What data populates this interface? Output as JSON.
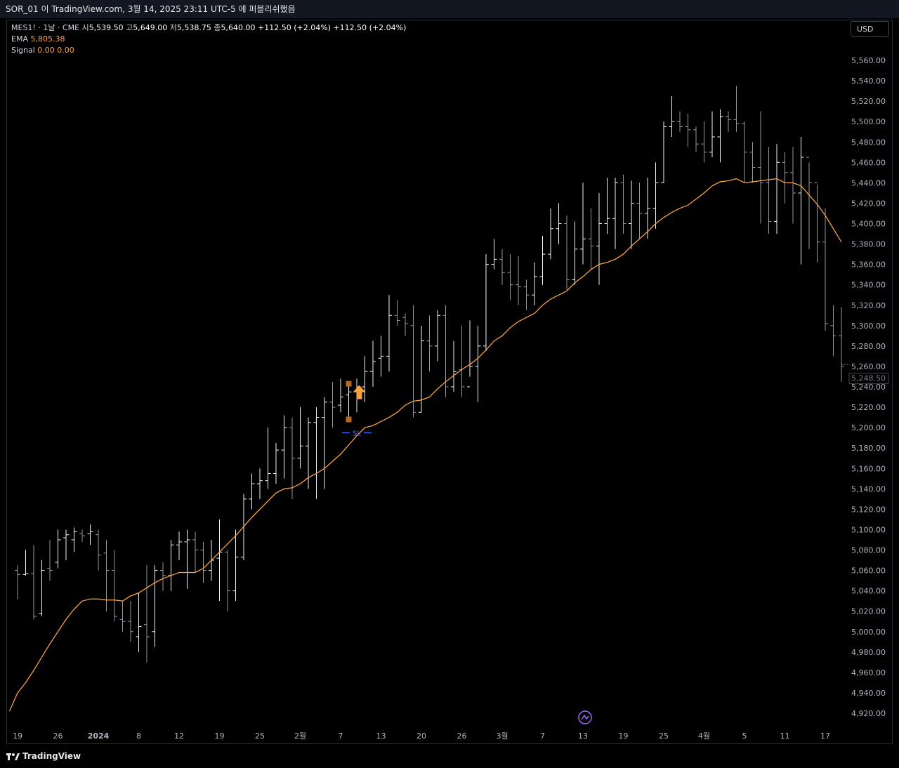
{
  "header": {
    "title": "SOR_01 이 TradingView.com, 3월 14, 2025 23:11 UTC-5 에 퍼블리쉬했음"
  },
  "legend": {
    "symbol": "MES1! · 1날 · CME",
    "open_label": "시",
    "open": "5,539.50",
    "high_label": "고",
    "high": "5,649.00",
    "low_label": "저",
    "low": "5,538.75",
    "close_label": "종",
    "close": "5,640.00",
    "change1": "+112.50 (+2.04%)",
    "change2": "+112.50 (+2.04%)",
    "ema_label": "EMA",
    "ema_value": "5,805.38",
    "signal_label": "Signal",
    "signal_v1": "0.00",
    "signal_v2": "0.00"
  },
  "currency": "USD",
  "brand": "TradingView",
  "stop_loss_label": "SL",
  "colors": {
    "background": "#000000",
    "bar": "#d1d4dc",
    "ema": "#f7a241",
    "signal_marker": "#f7a241",
    "stop_loss": "#2962ff",
    "price_tag": "#434651"
  },
  "chart_data": {
    "type": "ohlc",
    "title": "",
    "price_axis": {
      "ticks": [
        5560,
        5540,
        5520,
        5500,
        5480,
        5460,
        5440,
        5420,
        5400,
        5380,
        5360,
        5340,
        5320,
        5300,
        5280,
        5260,
        5240,
        5220,
        5200,
        5180,
        5160,
        5140,
        5120,
        5100,
        5080,
        5060,
        5040,
        5020,
        5000,
        4980,
        4960,
        4940,
        4920
      ],
      "tick_labels": [
        "5,560.00",
        "5,540.00",
        "5,520.00",
        "5,500.00",
        "5,480.00",
        "5,460.00",
        "5,440.00",
        "5,420.00",
        "5,400.00",
        "5,380.00",
        "5,360.00",
        "5,340.00",
        "5,320.00",
        "5,300.00",
        "5,280.00",
        "5,260.00",
        "5,240.00",
        "5,220.00",
        "5,200.00",
        "5,180.00",
        "5,160.00",
        "5,140.00",
        "5,120.00",
        "5,100.00",
        "5,080.00",
        "5,060.00",
        "5,040.00",
        "5,020.00",
        "5,000.00",
        "4,980.00",
        "4,960.00",
        "4,940.00",
        "4,920.00"
      ],
      "range": [
        4910,
        5580
      ],
      "last_price_label": "5,248.50",
      "last_price": 5248.5
    },
    "time_axis": {
      "labels": [
        "19",
        "26",
        "2024",
        "8",
        "12",
        "19",
        "25",
        "2월",
        "7",
        "13",
        "20",
        "26",
        "3월",
        "7",
        "13",
        "19",
        "25",
        "4월",
        "5",
        "11",
        "17"
      ],
      "label_bar_index": [
        0,
        5,
        10,
        15,
        20,
        25,
        30,
        35,
        40,
        45,
        50,
        55,
        60,
        65,
        70,
        75,
        80,
        85,
        90,
        95,
        100
      ]
    },
    "bars": [
      [
        5060,
        5065,
        5032,
        5056
      ],
      [
        5056,
        5080,
        5055,
        5057
      ],
      [
        5057,
        5085,
        5012,
        5015
      ],
      [
        5018,
        5070,
        5015,
        5060
      ],
      [
        5062,
        5090,
        5050,
        5060
      ],
      [
        5068,
        5100,
        5062,
        5090
      ],
      [
        5092,
        5100,
        5070,
        5095
      ],
      [
        5090,
        5102,
        5078,
        5098
      ],
      [
        5096,
        5100,
        5088,
        5094
      ],
      [
        5096,
        5105,
        5085,
        5098
      ],
      [
        5095,
        5100,
        5060,
        5075
      ],
      [
        5077,
        5090,
        5020,
        5060
      ],
      [
        5060,
        5080,
        5010,
        5015
      ],
      [
        5012,
        5030,
        5000,
        5010
      ],
      [
        5010,
        5030,
        4990,
        5000
      ],
      [
        4995,
        5038,
        4980,
        5005
      ],
      [
        5007,
        5065,
        4970,
        4995
      ],
      [
        5000,
        5065,
        4985,
        5060
      ],
      [
        5060,
        5068,
        5040,
        5055
      ],
      [
        5055,
        5090,
        5040,
        5085
      ],
      [
        5085,
        5098,
        5070,
        5088
      ],
      [
        5088,
        5100,
        5042,
        5090
      ],
      [
        5090,
        5098,
        5058,
        5080
      ],
      [
        5080,
        5088,
        5048,
        5060
      ],
      [
        5060,
        5090,
        5050,
        5070
      ],
      [
        5072,
        5110,
        5030,
        5078
      ],
      [
        5078,
        5080,
        5020,
        5040
      ],
      [
        5040,
        5100,
        5030,
        5073
      ],
      [
        5073,
        5135,
        5070,
        5130
      ],
      [
        5130,
        5155,
        5120,
        5145
      ],
      [
        5145,
        5160,
        5130,
        5148
      ],
      [
        5148,
        5200,
        5140,
        5155
      ],
      [
        5155,
        5185,
        5145,
        5178
      ],
      [
        5178,
        5212,
        5150,
        5200
      ],
      [
        5200,
        5210,
        5130,
        5170
      ],
      [
        5170,
        5220,
        5160,
        5182
      ],
      [
        5182,
        5210,
        5140,
        5205
      ],
      [
        5205,
        5220,
        5130,
        5210
      ],
      [
        5210,
        5230,
        5140,
        5225
      ],
      [
        5225,
        5245,
        5200,
        5220
      ],
      [
        5222,
        5248,
        5215,
        5230
      ],
      [
        5232,
        5243,
        5210,
        5235
      ],
      [
        5235,
        5248,
        5215,
        5240
      ],
      [
        5240,
        5270,
        5225,
        5255
      ],
      [
        5255,
        5285,
        5240,
        5265
      ],
      [
        5268,
        5290,
        5250,
        5270
      ],
      [
        5270,
        5330,
        5255,
        5310
      ],
      [
        5310,
        5325,
        5300,
        5305
      ],
      [
        5308,
        5312,
        5290,
        5302
      ],
      [
        5300,
        5320,
        5210,
        5215
      ],
      [
        5215,
        5300,
        5215,
        5285
      ],
      [
        5285,
        5310,
        5255,
        5280
      ],
      [
        5280,
        5315,
        5265,
        5310
      ],
      [
        5310,
        5320,
        5230,
        5240
      ],
      [
        5240,
        5285,
        5235,
        5255
      ],
      [
        5257,
        5300,
        5230,
        5240
      ],
      [
        5240,
        5305,
        5250,
        5260
      ],
      [
        5260,
        5300,
        5225,
        5280
      ],
      [
        5280,
        5370,
        5275,
        5360
      ],
      [
        5360,
        5385,
        5355,
        5365
      ],
      [
        5365,
        5375,
        5340,
        5352
      ],
      [
        5352,
        5370,
        5325,
        5340
      ],
      [
        5340,
        5368,
        5320,
        5338
      ],
      [
        5338,
        5345,
        5315,
        5330
      ],
      [
        5330,
        5362,
        5320,
        5348
      ],
      [
        5348,
        5388,
        5340,
        5370
      ],
      [
        5370,
        5415,
        5365,
        5395
      ],
      [
        5395,
        5420,
        5380,
        5400
      ],
      [
        5400,
        5408,
        5335,
        5345
      ],
      [
        5345,
        5402,
        5340,
        5375
      ],
      [
        5375,
        5440,
        5360,
        5385
      ],
      [
        5385,
        5415,
        5355,
        5378
      ],
      [
        5378,
        5430,
        5340,
        5400
      ],
      [
        5400,
        5445,
        5390,
        5405
      ],
      [
        5405,
        5445,
        5375,
        5440
      ],
      [
        5440,
        5448,
        5390,
        5400
      ],
      [
        5400,
        5442,
        5375,
        5420
      ],
      [
        5420,
        5440,
        5385,
        5410
      ],
      [
        5410,
        5445,
        5385,
        5415
      ],
      [
        5415,
        5460,
        5395,
        5440
      ],
      [
        5440,
        5500,
        5440,
        5495
      ],
      [
        5495,
        5525,
        5485,
        5500
      ],
      [
        5500,
        5510,
        5490,
        5495
      ],
      [
        5495,
        5508,
        5475,
        5492
      ],
      [
        5492,
        5495,
        5470,
        5478
      ],
      [
        5478,
        5500,
        5460,
        5470
      ],
      [
        5470,
        5510,
        5465,
        5485
      ],
      [
        5485,
        5512,
        5460,
        5505
      ],
      [
        5505,
        5510,
        5490,
        5502
      ],
      [
        5502,
        5535,
        5490,
        5498
      ],
      [
        5498,
        5500,
        5440,
        5470
      ],
      [
        5470,
        5480,
        5440,
        5455
      ],
      [
        5455,
        5510,
        5400,
        5440
      ],
      [
        5440,
        5475,
        5390,
        5402
      ],
      [
        5402,
        5478,
        5390,
        5460
      ],
      [
        5460,
        5470,
        5420,
        5450
      ],
      [
        5450,
        5475,
        5400,
        5430
      ],
      [
        5430,
        5485,
        5360,
        5465
      ],
      [
        5465,
        5460,
        5375,
        5440
      ],
      [
        5440,
        5438,
        5362,
        5382
      ],
      [
        5382,
        5415,
        5295,
        5302
      ],
      [
        5300,
        5320,
        5270,
        5290
      ],
      [
        5290,
        5318,
        5245,
        5260
      ]
    ],
    "ema": [
      4922,
      4940,
      4950,
      4962,
      4975,
      4988,
      5000,
      5012,
      5022,
      5030,
      5032,
      5032,
      5031,
      5031,
      5030,
      5035,
      5038,
      5043,
      5048,
      5052,
      5055,
      5058,
      5058,
      5058,
      5062,
      5070,
      5078,
      5086,
      5094,
      5103,
      5112,
      5120,
      5128,
      5136,
      5140,
      5141,
      5145,
      5151,
      5155,
      5160,
      5167,
      5174,
      5183,
      5192,
      5200,
      5202,
      5206,
      5210,
      5215,
      5222,
      5226,
      5227,
      5230,
      5238,
      5245,
      5251,
      5257,
      5262,
      5268,
      5276,
      5285,
      5290,
      5298,
      5304,
      5308,
      5312,
      5320,
      5326,
      5330,
      5334,
      5342,
      5348,
      5355,
      5360,
      5362,
      5365,
      5370,
      5378,
      5385,
      5392,
      5400,
      5406,
      5411,
      5415,
      5418,
      5424,
      5430,
      5437,
      5441,
      5442,
      5444,
      5440,
      5441,
      5442,
      5443,
      5444,
      5440,
      5440,
      5437,
      5428,
      5419,
      5408,
      5395,
      5382
    ]
  },
  "signal": {
    "bar_index": 41,
    "arrow_price": 5232,
    "marker_upper_price": 5243,
    "marker_lower_price": 5208,
    "stop_loss_price": 5195,
    "stop_loss_from_bar": 40,
    "stop_loss_to_bar": 44
  }
}
